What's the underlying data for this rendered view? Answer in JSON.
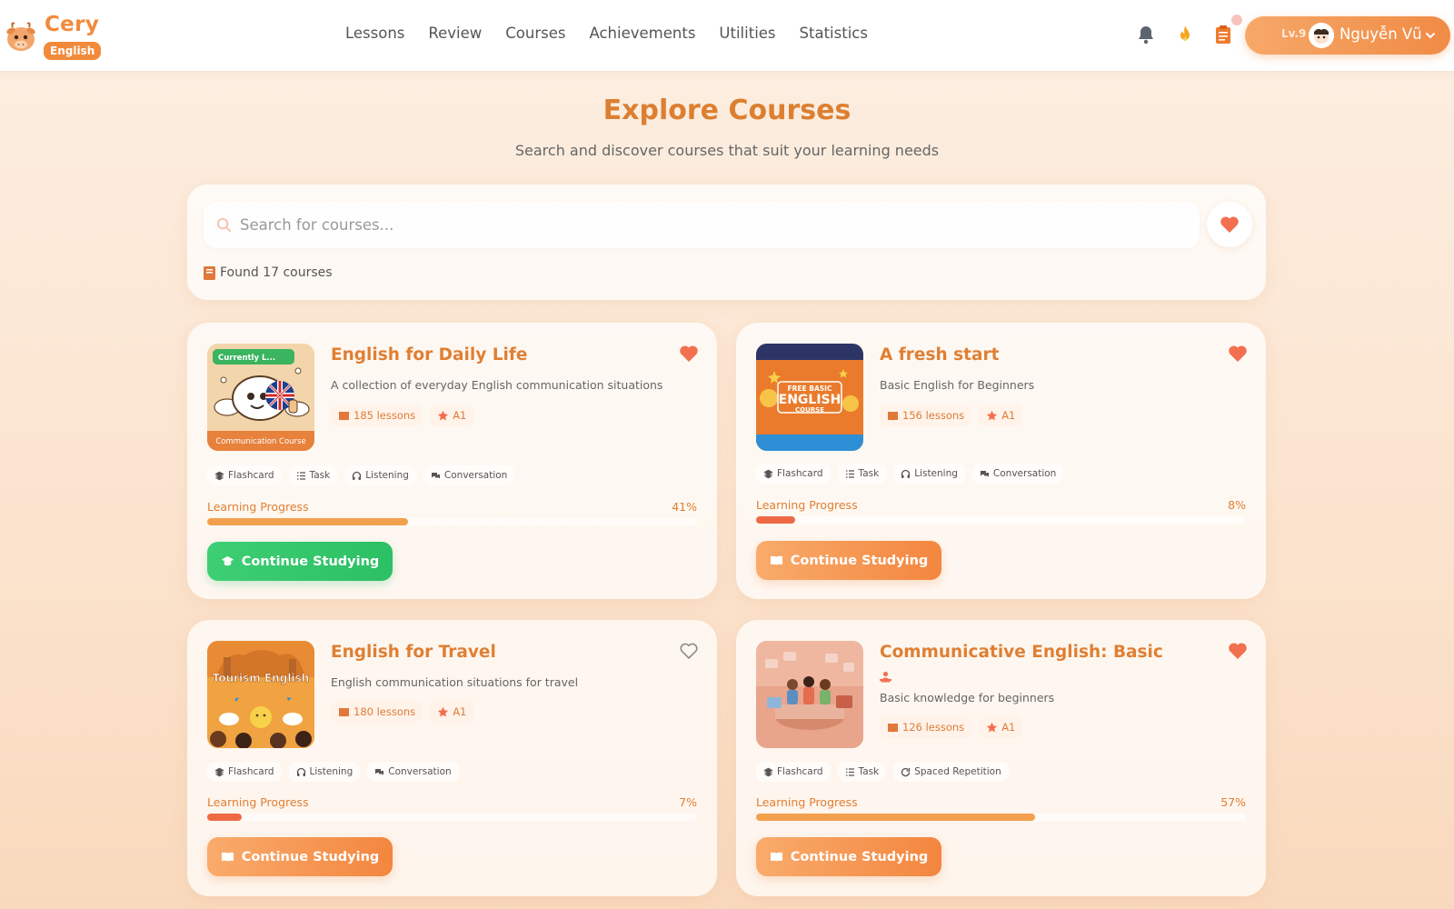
{
  "brand": {
    "name": "Cery",
    "badge": "English"
  },
  "nav": {
    "links": [
      "Lessons",
      "Review",
      "Courses",
      "Achievements",
      "Utilities",
      "Statistics"
    ]
  },
  "user": {
    "level": "Lv.9",
    "name": "Nguyễn Vũ"
  },
  "hero": {
    "title": "Explore Courses",
    "subtitle": "Search and discover courses that suit your learning needs"
  },
  "search": {
    "placeholder": "Search for courses...",
    "found": "Found 17 courses"
  },
  "courses": [
    {
      "title": "English for Daily Life",
      "description": "A collection of everyday English communication situations",
      "lessons": "185 lessons",
      "level": "A1",
      "features": [
        "Flashcard",
        "Task",
        "Listening",
        "Conversation"
      ],
      "progress_label": "Learning Progress",
      "progress_text": "41%",
      "progress": 41,
      "cta": "Continue Studying",
      "cta_style": "green",
      "favorite": true,
      "thumb_ribbon": "Currently L...",
      "thumb_caption": "Communication Course"
    },
    {
      "title": "A fresh start",
      "description": "Basic English for Beginners",
      "lessons": "156 lessons",
      "level": "A1",
      "features": [
        "Flashcard",
        "Task",
        "Listening",
        "Conversation"
      ],
      "progress_label": "Learning Progress",
      "progress_text": "8%",
      "progress": 8,
      "cta": "Continue Studying",
      "cta_style": "orange",
      "favorite": true,
      "thumb_line1": "FREE BASIC",
      "thumb_line2": "ENGLISH",
      "thumb_line3": "COURSE"
    },
    {
      "title": "English for Travel",
      "description": "English communication situations for travel",
      "lessons": "180 lessons",
      "level": "A1",
      "features": [
        "Flashcard",
        "Listening",
        "Conversation"
      ],
      "progress_label": "Learning Progress",
      "progress_text": "7%",
      "progress": 7,
      "cta": "Continue Studying",
      "cta_style": "orange",
      "favorite": false,
      "thumb_title": "Tourism English"
    },
    {
      "title": "Communicative English: Basic",
      "description": "Basic knowledge for beginners",
      "lessons": "126 lessons",
      "level": "A1",
      "features": [
        "Flashcard",
        "Task",
        "Spaced Repetition"
      ],
      "progress_label": "Learning Progress",
      "progress_text": "57%",
      "progress": 57,
      "cta": "Continue Studying",
      "cta_style": "orange",
      "favorite": true
    }
  ],
  "colors": {
    "accent": "#f28a3c",
    "title": "#e07f33",
    "heart": "#f2704f",
    "progress_orange": "#f3a04e",
    "progress_red": "#ee6a44",
    "green": "#2cbf63"
  },
  "icons": {
    "bell": "bell-icon",
    "streak": "flame-icon",
    "tasks": "clipboard-icon",
    "search": "search-icon",
    "favorite": "heart-icon",
    "lessons": "book-icon",
    "level": "star-icon"
  }
}
